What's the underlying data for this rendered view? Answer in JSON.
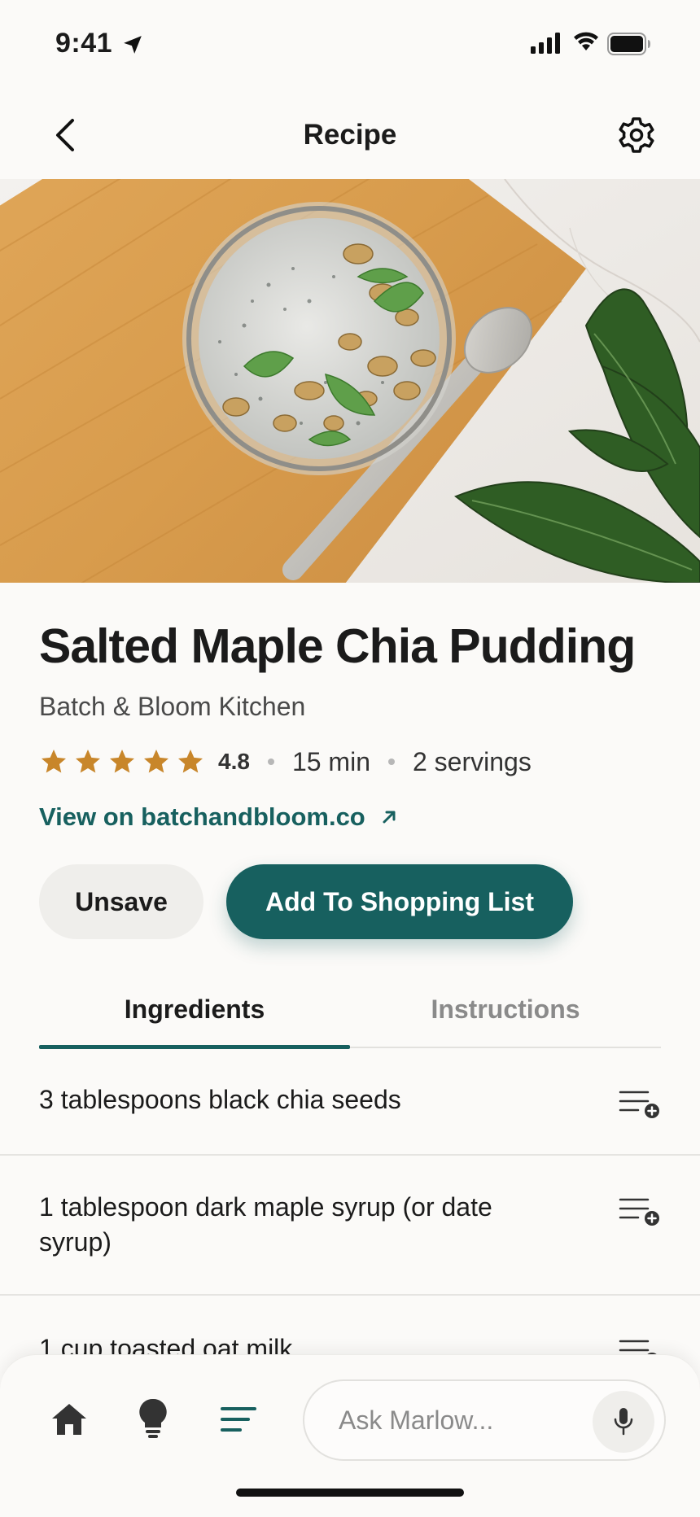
{
  "status_bar": {
    "time": "9:41"
  },
  "header": {
    "title": "Recipe"
  },
  "hero": {
    "alt": "chia pudding bowl on wooden board"
  },
  "recipe": {
    "title": "Salted Maple Chia Pudding",
    "source": "Batch & Bloom Kitchen",
    "stars": 5,
    "rating": "4.8",
    "time": "15 min",
    "servings": "2 servings",
    "link_label": "View on batchandbloom.co"
  },
  "actions": {
    "unsave_label": "Unsave",
    "add_label": "Add To Shopping List"
  },
  "tabs": [
    {
      "label": "Ingredients",
      "active": true
    },
    {
      "label": "Instructions",
      "active": false
    }
  ],
  "ingredients": [
    "3 tablespoons black chia seeds",
    "1 tablespoon dark maple syrup (or date syrup)",
    "1 cup toasted oat milk"
  ],
  "bottom_bar": {
    "ask_placeholder": "Ask Marlow...",
    "active_nav": "list"
  },
  "colors": {
    "accent": "#17605f",
    "star": "#c8862a",
    "background": "#fbfaf8"
  }
}
